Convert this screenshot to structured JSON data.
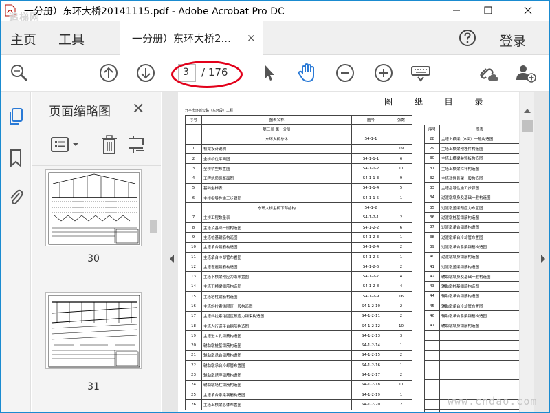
{
  "window": {
    "title": "一分册）东环大桥20141115.pdf - Adobe Acrobat Pro DC",
    "watermark_top": "追梯网"
  },
  "menu": {
    "home": "主页",
    "tools": "工具",
    "login": "登录"
  },
  "tab": {
    "label": "一分册）东环大桥2...",
    "close": "×"
  },
  "toolbar": {
    "page_current": "3",
    "page_total": "/ 176"
  },
  "thumbnails": {
    "title": "页面缩略图",
    "close": "✕",
    "pages": [
      {
        "label": "30"
      },
      {
        "label": "31"
      }
    ]
  },
  "document": {
    "title": "图 纸 目 录",
    "subtitle": "开平市环城公路（东环段）工程",
    "headers": {
      "no": "序号",
      "name": "图表名称",
      "code": "图号",
      "sheets": "张数"
    },
    "right_header_name": "图表",
    "left_rows": [
      {
        "full": "第三册 第一分册"
      },
      {
        "group": "东环大桥总体",
        "code": "S4-1-1"
      },
      {
        "no": "1",
        "name": "桥梁设计说明",
        "code": "",
        "sheets": "19"
      },
      {
        "no": "2",
        "name": "全桥桥位平面图",
        "code": "S4-1-1-1",
        "sheets": "6"
      },
      {
        "no": "3",
        "name": "全桥桥型布置图",
        "code": "S4-1-1-2",
        "sheets": "11"
      },
      {
        "no": "4",
        "name": "工程地质纵断面图",
        "code": "S4-1-1-3",
        "sheets": "9"
      },
      {
        "no": "5",
        "name": "基础坐标表",
        "code": "S4-1-1-4",
        "sheets": "5"
      },
      {
        "no": "6",
        "name": "主桥指导性施工步骤图",
        "code": "S4-1-1-5",
        "sheets": "1"
      },
      {
        "group": "东环大桥主桥下部结构",
        "code": "S4-1-2"
      },
      {
        "no": "7",
        "name": "主桥工程数量表",
        "code": "S4-1-2-1",
        "sheets": "2"
      },
      {
        "no": "8",
        "name": "主塔及基础一般构造图",
        "code": "S4-1-2-2",
        "sheets": "6"
      },
      {
        "no": "9",
        "name": "主塔桩基钢筋构造图",
        "code": "S4-1-2-3",
        "sheets": "1"
      },
      {
        "no": "10",
        "name": "主塔承台钢筋构造图",
        "code": "S4-1-2-4",
        "sheets": "2"
      },
      {
        "no": "11",
        "name": "主塔承台冷却管布置图",
        "code": "S4-1-2-5",
        "sheets": "1"
      },
      {
        "no": "12",
        "name": "主塔塔座钢筋构造图",
        "code": "S4-1-2-6",
        "sheets": "2"
      },
      {
        "no": "13",
        "name": "主塔下横梁预应力束布置图",
        "code": "S4-1-2-7",
        "sheets": "4"
      },
      {
        "no": "14",
        "name": "主塔下横梁钢筋构造图",
        "code": "S4-1-2-8",
        "sheets": "4"
      },
      {
        "no": "15",
        "name": "主塔塔柱钢筋构造图",
        "code": "S4-1-2-9",
        "sheets": "16"
      },
      {
        "no": "16",
        "name": "主塔斜拉索锚固区一般构造图",
        "code": "S4-1-2-10",
        "sheets": "2"
      },
      {
        "no": "17",
        "name": "主塔斜拉索锚固区预应力钢束构造图",
        "code": "S4-1-2-11",
        "sheets": "2"
      },
      {
        "no": "18",
        "name": "主塔人行道平台钢筋构造图",
        "code": "S4-1-2-12",
        "sheets": "10"
      },
      {
        "no": "19",
        "name": "主塔进人孔钢筋构造图",
        "code": "S4-1-2-13",
        "sheets": "3"
      },
      {
        "no": "20",
        "name": "辅助墩桩基钢筋构造图",
        "code": "S4-1-2-14",
        "sheets": "1"
      },
      {
        "no": "21",
        "name": "辅助墩承台钢筋构造图",
        "code": "S4-1-2-15",
        "sheets": "2"
      },
      {
        "no": "22",
        "name": "辅助墩承台冷却管布置图",
        "code": "S4-1-2-16",
        "sheets": "1"
      },
      {
        "no": "23",
        "name": "辅助墩塔座钢筋构造图",
        "code": "S4-1-2-17",
        "sheets": "2"
      },
      {
        "no": "24",
        "name": "辅助墩塔柱钢筋构造图",
        "code": "S4-1-2-18",
        "sheets": "11"
      },
      {
        "no": "25",
        "name": "主塔承台系梁钢筋构造图",
        "code": "S4-1-2-19",
        "sheets": "1"
      },
      {
        "no": "26",
        "name": "主塔上横梁总体布置图",
        "code": "S4-1-2-20",
        "sheets": "2"
      }
    ],
    "right_rows": [
      {
        "no": "28",
        "name": "主塔上横梁（B类）一般构造图"
      },
      {
        "no": "29",
        "name": "主塔上横梁预埋件构造图"
      },
      {
        "no": "30",
        "name": "主塔上横梁装饰板构造图"
      },
      {
        "no": "31",
        "name": "主塔上横梁栏杆构造图"
      },
      {
        "no": "32",
        "name": "主塔劲性骨架一般构造图"
      },
      {
        "no": "33",
        "name": "主塔指导性施工步骤图"
      },
      {
        "no": "34",
        "name": "过渡墩墩身及基础一般构造图"
      },
      {
        "no": "35",
        "name": "过渡墩盖梁预应力布置图"
      },
      {
        "no": "36",
        "name": "过渡墩桩基钢筋构造图"
      },
      {
        "no": "37",
        "name": "过渡墩承台钢筋构造图"
      },
      {
        "no": "38",
        "name": "过渡墩承台冷却管布置图"
      },
      {
        "no": "39",
        "name": "过渡墩承台系梁钢筋构造图"
      },
      {
        "no": "40",
        "name": "过渡墩墩身钢筋构造图"
      },
      {
        "no": "41",
        "name": "过渡墩盖梁钢筋构造图"
      },
      {
        "no": "42",
        "name": "辅助墩墩身及基础一般构造图"
      },
      {
        "no": "43",
        "name": "辅助墩桩基钢筋构造图"
      },
      {
        "no": "44",
        "name": "辅助墩承台钢筋构造图"
      },
      {
        "no": "45",
        "name": "辅助墩承台冷却管布置图"
      },
      {
        "no": "46",
        "name": "辅助墩承台系梁钢筋构造图"
      },
      {
        "no": "47",
        "name": "辅助墩墩身钢筋构造图"
      }
    ]
  },
  "watermark_bottom": "www.cndao.com",
  "colors": {
    "accent": "#1a8bd0",
    "highlight": "#e2001a",
    "hand": "#2a7ad6"
  }
}
